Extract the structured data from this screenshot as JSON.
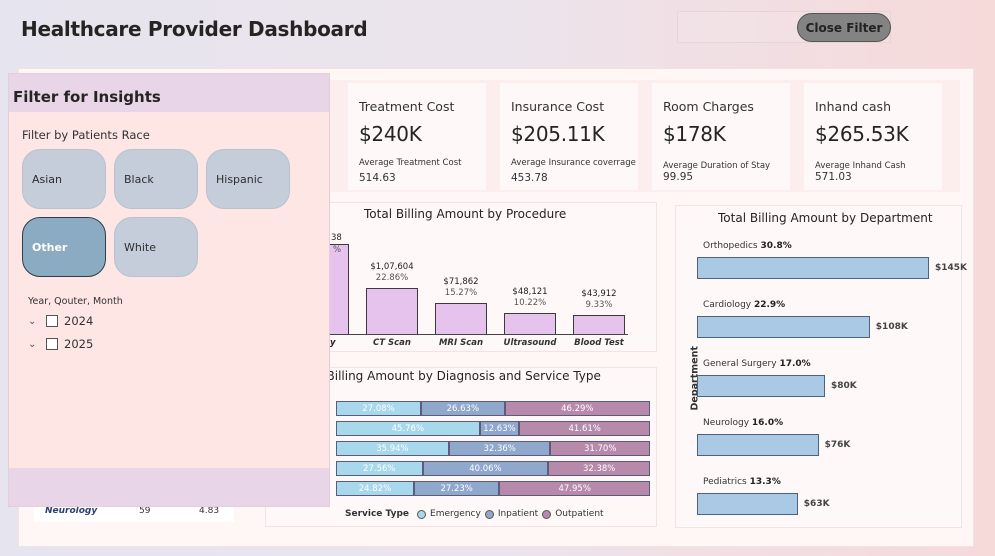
{
  "header": {
    "title": "Healthcare Provider Dashboard",
    "close_filter_label": "Close Filter"
  },
  "kpis": [
    {
      "title": "Treatment Cost",
      "value": "$240K",
      "sub_label": "Average Treatment Cost",
      "sub_value": "514.63"
    },
    {
      "title": "Insurance Cost",
      "value": "$205.11K",
      "sub_label": "Average Insurance coverrage",
      "sub_value": "453.78"
    },
    {
      "title": "Room Charges",
      "value": "$178K",
      "sub_label": "Average Duration of Stay",
      "sub_value": "99.95"
    },
    {
      "title": "Inhand cash",
      "value": "$265.53K",
      "sub_label": "Average Inhand Cash",
      "sub_value": "571.03"
    }
  ],
  "procedure_chart": {
    "title": "Total Billing Amount by Procedure",
    "partial_value": "38",
    "partial_pct": "%",
    "partial_cat": "y"
  },
  "diagnosis_chart": {
    "title": "al Billing Amount by Diagnosis and Service Type",
    "legend_title": "Service Type",
    "legend": [
      "Emergency",
      "Inpatient",
      "Outpatient"
    ]
  },
  "department_chart": {
    "title": "Total Billing Amount by Department",
    "axis_title": "Department"
  },
  "chart_data": [
    {
      "type": "bar",
      "title": "Total Billing Amount by Procedure",
      "categories": [
        "CT Scan",
        "MRI Scan",
        "Ultrasound",
        "Blood Test"
      ],
      "values": [
        107604,
        71862,
        48121,
        43912
      ],
      "value_labels": [
        "$1,07,604",
        "$71,862",
        "$48,121",
        "$43,912"
      ],
      "percent_labels": [
        "22.86%",
        "15.27%",
        "10.22%",
        "9.33%"
      ]
    },
    {
      "type": "bar",
      "stacked": true,
      "orientation": "horizontal",
      "title": "al Billing Amount by Diagnosis and Service Type",
      "series": [
        {
          "name": "Emergency",
          "values": [
            27.08,
            45.76,
            35.94,
            27.56,
            24.82
          ],
          "labels": [
            "27.08%",
            "45.76%",
            "35.94%",
            "27.56%",
            "24.82%"
          ]
        },
        {
          "name": "Inpatient",
          "values": [
            26.63,
            12.63,
            32.36,
            40.06,
            27.23
          ],
          "labels": [
            "26.63%",
            "12.63%",
            "32.36%",
            "40.06%",
            "27.23%"
          ]
        },
        {
          "name": "Outpatient",
          "values": [
            46.29,
            41.61,
            31.7,
            32.38,
            47.95
          ],
          "labels": [
            "46.29%",
            "41.61%",
            "31.70%",
            "32.38%",
            "47.95%"
          ]
        }
      ],
      "legend_title": "Service Type",
      "legend_placement": "bottom"
    },
    {
      "type": "bar",
      "orientation": "horizontal",
      "title": "Total Billing Amount by Department",
      "ylabel": "Department",
      "categories": [
        "Orthopedics",
        "Cardiology",
        "General Surgery",
        "Neurology",
        "Pediatrics"
      ],
      "values": [
        145,
        108,
        80,
        76,
        63
      ],
      "value_labels": [
        "$145K",
        "$108K",
        "$80K",
        "$76K",
        "$63K"
      ],
      "percent_labels": [
        "30.8%",
        "22.9%",
        "17.0%",
        "16.0%",
        "13.3%"
      ]
    }
  ],
  "filter_panel": {
    "title": "Filter for Insights",
    "race_label": "Filter by Patients Race",
    "races": [
      {
        "label": "Asian",
        "selected": false
      },
      {
        "label": "Black",
        "selected": false
      },
      {
        "label": "Hispanic",
        "selected": false
      },
      {
        "label": "Other",
        "selected": true
      },
      {
        "label": "White",
        "selected": false
      }
    ],
    "hierarchy_label": "Year, Qouter, Month",
    "years": [
      "2024",
      "2025"
    ]
  },
  "table_row": {
    "name": "Neurology",
    "count": "59",
    "value": "4.83"
  }
}
